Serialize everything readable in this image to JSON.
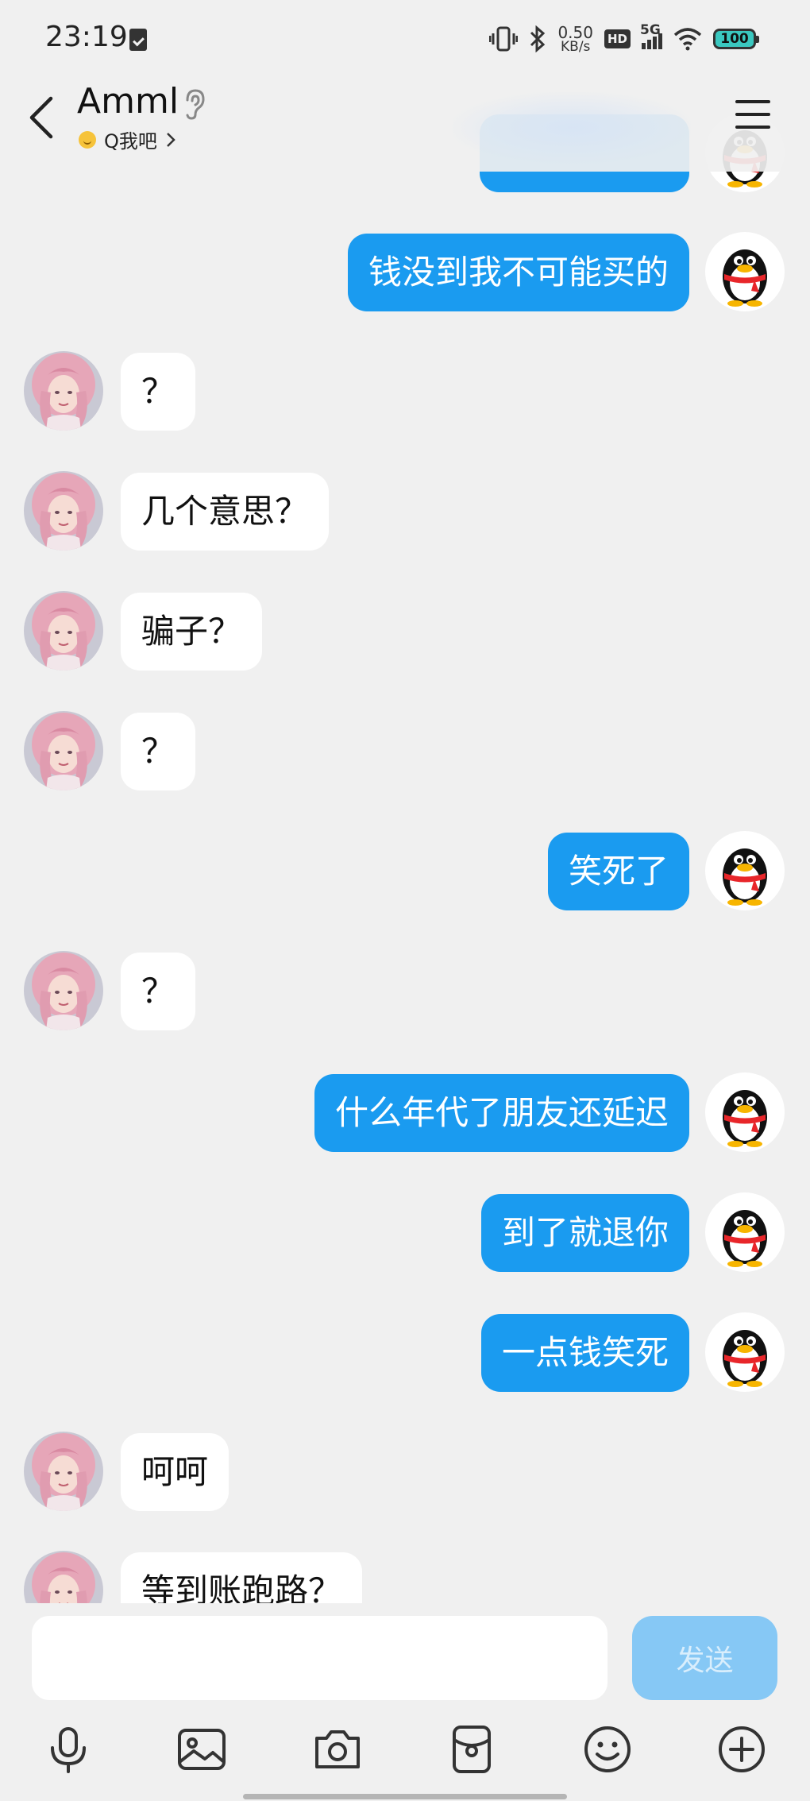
{
  "status_bar": {
    "time": "23:19",
    "net_speed_value": "0.50",
    "net_speed_unit": "KB/s",
    "hd": "HD",
    "network": "5G",
    "battery": "100"
  },
  "header": {
    "contact_name": "Amml",
    "presence_label": "Q我吧",
    "icons": [
      "back-arrow-icon",
      "ear-icon",
      "menu-icon"
    ]
  },
  "messages": [
    {
      "sender": "me",
      "text": "钱没到我不可能买的"
    },
    {
      "sender": "other",
      "text": "？"
    },
    {
      "sender": "other",
      "text": "几个意思？"
    },
    {
      "sender": "other",
      "text": "骗子？"
    },
    {
      "sender": "other",
      "text": "？"
    },
    {
      "sender": "me",
      "text": "笑死了"
    },
    {
      "sender": "other",
      "text": "？"
    },
    {
      "sender": "me",
      "text": "什么年代了朋友还延迟"
    },
    {
      "sender": "me",
      "text": "到了就退你"
    },
    {
      "sender": "me",
      "text": "一点钱笑死"
    },
    {
      "sender": "other",
      "text": "呵呵"
    },
    {
      "sender": "other",
      "text": "等到账跑路？"
    }
  ],
  "input": {
    "value": "",
    "send_label": "发送"
  },
  "toolbar": {
    "icons": [
      "microphone-icon",
      "image-icon",
      "camera-icon",
      "red-packet-icon",
      "emoji-icon",
      "plus-icon"
    ]
  },
  "colors": {
    "background": "#f0f0f0",
    "my_bubble": "#1a9bf0",
    "other_bubble": "#ffffff",
    "send_button_disabled": "#86c8f5"
  }
}
